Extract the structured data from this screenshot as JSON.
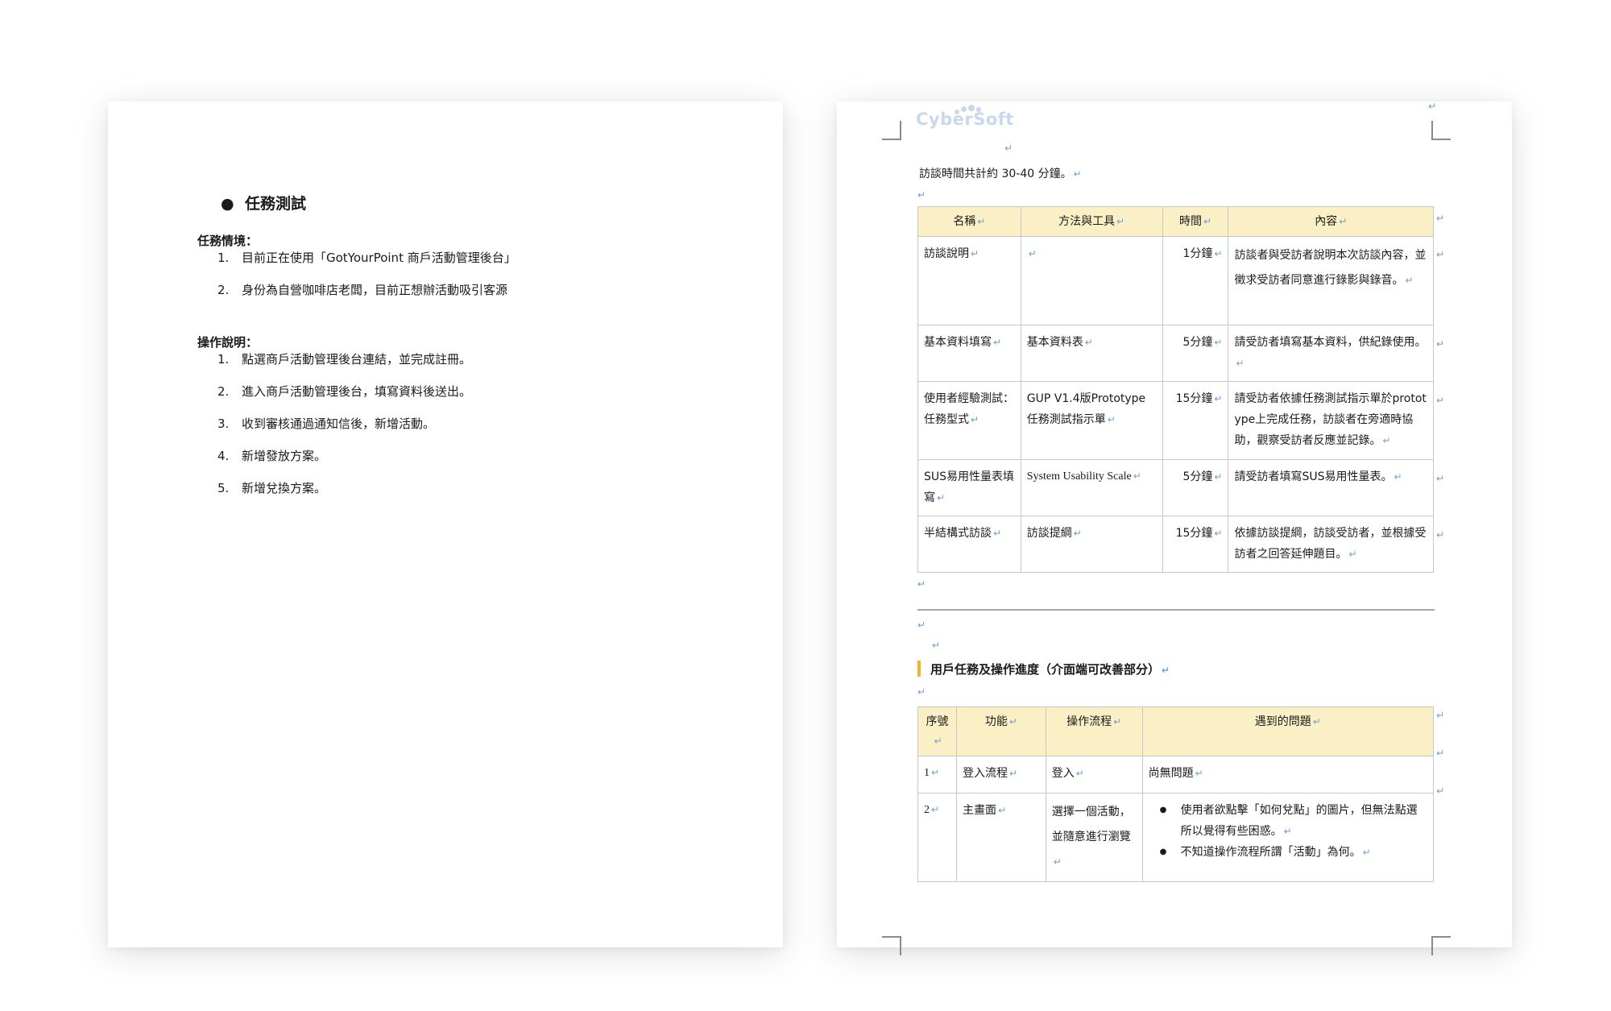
{
  "left_page": {
    "heading": "任務測試",
    "scenario_label": "任務情境：",
    "scenario_items": [
      {
        "num": "1.",
        "text": "目前正在使用「GotYourPoint 商戶活動管理後台」"
      },
      {
        "num": "2.",
        "text": "身份為自營咖啡店老闆，目前正想辦活動吸引客源"
      }
    ],
    "operation_label": "操作說明：",
    "operation_items": [
      {
        "num": "1.",
        "text": "點選商戶活動管理後台連結，並完成註冊。"
      },
      {
        "num": "2.",
        "text": "進入商戶活動管理後台，填寫資料後送出。"
      },
      {
        "num": "3.",
        "text": "收到審核通過通知信後，新增活動。"
      },
      {
        "num": "4.",
        "text": "新增發放方案。"
      },
      {
        "num": "5.",
        "text": "新增兌換方案。"
      }
    ]
  },
  "right_page": {
    "logo_text": "CyberSoft",
    "paragraph_mark": "↵",
    "intro": "訪談時間共計約 30-40 分鐘。",
    "table1": {
      "headers": [
        "名稱",
        "方法與工具",
        "時間",
        "內容"
      ],
      "rows": [
        {
          "name": "訪談說明",
          "tool": "",
          "time": "1分鐘",
          "content": "訪談者與受訪者說明本次訪談內容，並徵求受訪者同意進行錄影與錄音。"
        },
        {
          "name": "基本資料填寫",
          "tool": "基本資料表",
          "time": "5分鐘",
          "content": "請受訪者填寫基本資料，供紀錄使用。"
        },
        {
          "name": "使用者經驗測試：任務型式",
          "tool": "GUP V1.4版Prototype任務測試指示單",
          "time": "15分鐘",
          "content": "請受訪者依據任務測試指示單於prototype上完成任務，訪談者在旁適時協助，觀察受訪者反應並記錄。"
        },
        {
          "name": "SUS易用性量表填寫",
          "tool": "System Usability Scale",
          "time": "5分鐘",
          "content": "請受訪者填寫SUS易用性量表。"
        },
        {
          "name": "半結構式訪談",
          "tool": "訪談提綱",
          "time": "15分鐘",
          "content": "依據訪談提綱，訪談受訪者，並根據受訪者之回答延伸題目。"
        }
      ]
    },
    "section2_title": "用戶任務及操作進度（介面端可改善部分）",
    "table2": {
      "headers": [
        "序號",
        "功能",
        "操作流程",
        "遇到的問題"
      ],
      "rows": [
        {
          "no": "1",
          "feature": "登入流程",
          "flow": "登入",
          "issue": "尚無問題"
        },
        {
          "no": "2",
          "feature": "主畫面",
          "flow": "選擇一個活動，並隨意進行瀏覽",
          "issues": [
            "使用者欲點擊「如何兌點」的圖片，但無法點選所以覺得有些困惑。",
            "不知道操作流程所謂「活動」為何。"
          ]
        }
      ]
    }
  }
}
